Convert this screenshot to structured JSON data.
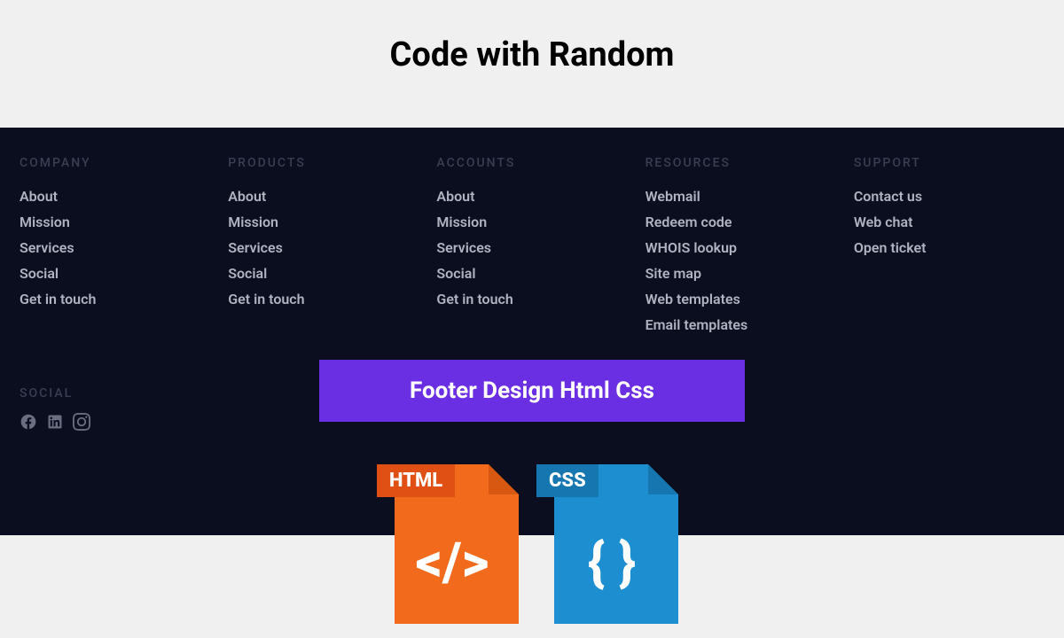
{
  "header": {
    "title": "Code with Random"
  },
  "footer": {
    "columns": [
      {
        "heading": "COMPANY",
        "links": [
          "About",
          "Mission",
          "Services",
          "Social",
          "Get in touch"
        ]
      },
      {
        "heading": "PRODUCTS",
        "links": [
          "About",
          "Mission",
          "Services",
          "Social",
          "Get in touch"
        ]
      },
      {
        "heading": "ACCOUNTS",
        "links": [
          "About",
          "Mission",
          "Services",
          "Social",
          "Get in touch"
        ]
      },
      {
        "heading": "RESOURCES",
        "links": [
          "Webmail",
          "Redeem code",
          "WHOIS lookup",
          "Site map",
          "Web templates",
          "Email templates"
        ]
      },
      {
        "heading": "SUPPORT",
        "links": [
          "Contact us",
          "Web chat",
          "Open ticket"
        ]
      }
    ],
    "social_heading": "SOCIAL"
  },
  "banner": {
    "text": "Footer Design Html Css"
  },
  "files": {
    "html": {
      "label": "HTML",
      "symbol": "</>"
    },
    "css": {
      "label": "CSS",
      "symbol": "{ }"
    }
  }
}
